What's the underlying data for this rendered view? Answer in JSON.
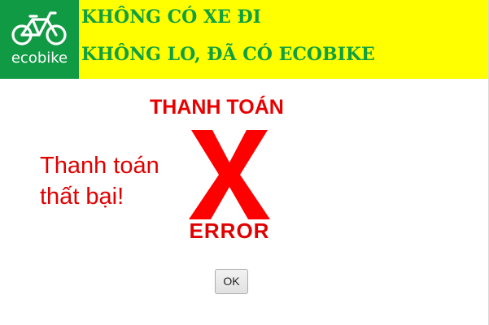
{
  "header": {
    "logo_text": "ecobike",
    "logo_icon": "bicycle-icon",
    "slogan_line_1": "KHÔNG CÓ XE ĐI",
    "slogan_line_2": "KHÔNG LO, ĐÃ CÓ ECOBIKE",
    "colors": {
      "header_background": "#ffff00",
      "logo_background": "#109a44",
      "slogan_text": "#10a040"
    }
  },
  "main": {
    "title": "THANH TOÁN",
    "message": "Thanh toán thất bại!",
    "error_icon": "error-x-icon",
    "error_label": "ERROR",
    "colors": {
      "error_red": "#e80000"
    }
  },
  "actions": {
    "ok_label": "OK"
  }
}
